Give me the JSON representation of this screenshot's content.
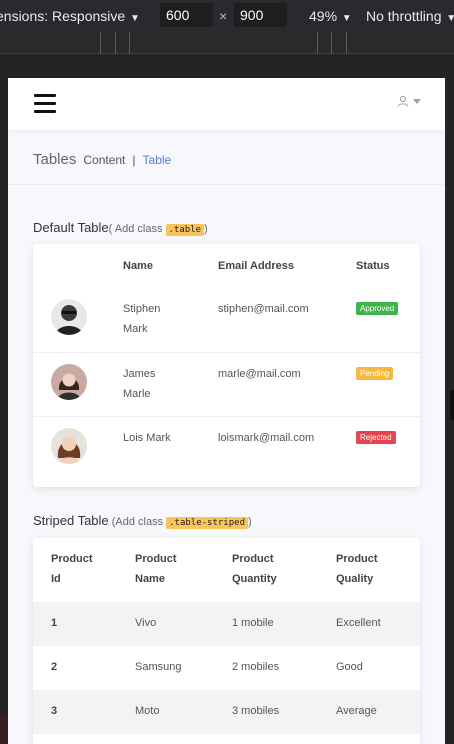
{
  "devtools": {
    "device_label": "ensions: Responsive",
    "width": "600",
    "times": "×",
    "height": "900",
    "zoom": "49%",
    "throttle": "No throttling"
  },
  "header": {
    "user_icon": "user-icon"
  },
  "breadcrumb": {
    "title": "Tables",
    "section": "Content",
    "separator": "|",
    "current": "Table"
  },
  "default_table": {
    "heading": "Default Table",
    "hint_open": "( Add class ",
    "hint_code": ".table",
    "hint_close": ")",
    "columns": [
      "Name",
      "Email Address",
      "Status"
    ],
    "rows": [
      {
        "name_line1": "Stiphen",
        "name_line2": "Mark",
        "email": "stiphen@mail.com",
        "status": "Approved",
        "status_color": "#3bb54a"
      },
      {
        "name_line1": "James",
        "name_line2": "Marle",
        "email": "marle@mail.com",
        "status": "Pending",
        "status_color": "#f5b942"
      },
      {
        "name_line1": "Lois Mark",
        "name_line2": "",
        "email": "loismark@mail.com",
        "status": "Rejected",
        "status_color": "#e2454f"
      }
    ]
  },
  "striped_table": {
    "heading": "Striped Table",
    "hint_open": " (Add class ",
    "hint_code": ".table-striped",
    "hint_close": ")",
    "columns": [
      {
        "line1": "Product",
        "line2": "Id"
      },
      {
        "line1": "Product",
        "line2": "Name"
      },
      {
        "line1": "Product",
        "line2": "Quantity"
      },
      {
        "line1": "Product",
        "line2": "Quality"
      }
    ],
    "rows": [
      {
        "id": "1",
        "name": "Vivo",
        "qty": "1 mobile",
        "quality": "Excellent"
      },
      {
        "id": "2",
        "name": "Samsung",
        "qty": "2 mobiles",
        "quality": "Good"
      },
      {
        "id": "3",
        "name": "Moto",
        "qty": "3 mobiles",
        "quality": "Average"
      }
    ]
  }
}
